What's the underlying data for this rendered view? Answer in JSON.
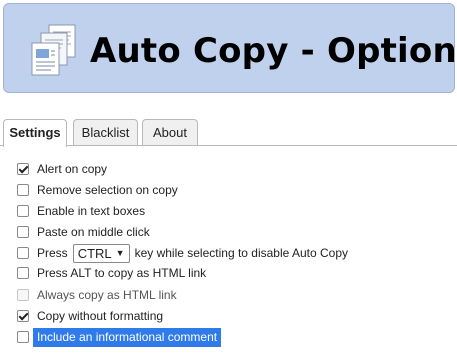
{
  "header": {
    "title": "Auto Copy - Options",
    "logo_icon": "copy-documents-icon",
    "background_color": "#bfd1ec"
  },
  "tabs": [
    {
      "label": "Settings",
      "active": true
    },
    {
      "label": "Blacklist",
      "active": false
    },
    {
      "label": "About",
      "active": false
    }
  ],
  "options": {
    "alert_on_copy": {
      "label": "Alert on copy",
      "checked": true
    },
    "remove_selection": {
      "label": "Remove selection on copy",
      "checked": false
    },
    "enable_text_boxes": {
      "label": "Enable in text boxes",
      "checked": false
    },
    "paste_middle_click": {
      "label": "Paste on middle click",
      "checked": false
    },
    "modifier_key": {
      "prefix": "Press",
      "selected_key": "CTRL",
      "suffix": "key while selecting to disable Auto Copy",
      "checked": false
    },
    "alt_html_link": {
      "label": "Press ALT to copy as HTML link",
      "checked": false
    },
    "always_html_link": {
      "label": "Always copy as HTML link",
      "checked": false,
      "disabled": true
    },
    "copy_without_formatting": {
      "label": "Copy without formatting",
      "checked": true
    },
    "informational_comment": {
      "label": "Include an informational comment",
      "checked": false,
      "highlighted": true
    }
  },
  "colors": {
    "highlight": "#2f7bea"
  }
}
